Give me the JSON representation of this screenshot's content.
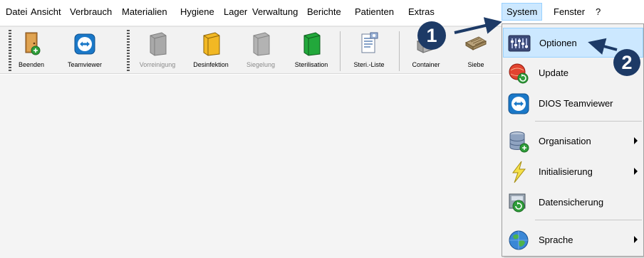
{
  "menubar": {
    "items": [
      "Datei",
      "Ansicht",
      "Verbrauch",
      "Materialien",
      "Hygiene",
      "Lager",
      "Verwaltung",
      "Berichte",
      "Patienten",
      "Extras",
      "System",
      "Fenster",
      "?"
    ],
    "active": "System"
  },
  "toolbar": {
    "buttons": [
      {
        "label": "Beenden",
        "icon": "exit-door-icon",
        "enabled": true
      },
      {
        "label": "Teamviewer",
        "icon": "teamviewer-icon",
        "enabled": true
      },
      {
        "label": "Vorreinigung",
        "icon": "book-gray-icon",
        "enabled": false
      },
      {
        "label": "Desinfektion",
        "icon": "book-yellow-icon",
        "enabled": true
      },
      {
        "label": "Siegelung",
        "icon": "book-gray-icon",
        "enabled": false
      },
      {
        "label": "Sterilisation",
        "icon": "book-green-icon",
        "enabled": true
      },
      {
        "label": "Steri.-Liste",
        "icon": "document-list-icon",
        "enabled": true
      },
      {
        "label": "Container",
        "icon": "container-icon",
        "enabled": true
      },
      {
        "label": "Siebe",
        "icon": "tray-icon",
        "enabled": true
      }
    ]
  },
  "system_menu": {
    "items": [
      {
        "label": "Optionen",
        "icon": "options-panel-icon",
        "submenu": false,
        "highlighted": true
      },
      {
        "label": "Update",
        "icon": "update-globe-icon",
        "submenu": false
      },
      {
        "label": "DIOS Teamviewer",
        "icon": "teamviewer-icon",
        "submenu": false
      },
      {
        "label": "Organisation",
        "icon": "database-icon",
        "submenu": true
      },
      {
        "label": "Initialisierung",
        "icon": "lightning-icon",
        "submenu": true
      },
      {
        "label": "Datensicherung",
        "icon": "backup-icon",
        "submenu": false
      },
      {
        "label": "Sprache",
        "icon": "globe-icon",
        "submenu": true
      }
    ]
  },
  "callouts": {
    "first": "1",
    "second": "2"
  },
  "colors": {
    "callout": "#1d3a66",
    "highlight": "#cce8ff",
    "highlight_border": "#99d1ff"
  }
}
